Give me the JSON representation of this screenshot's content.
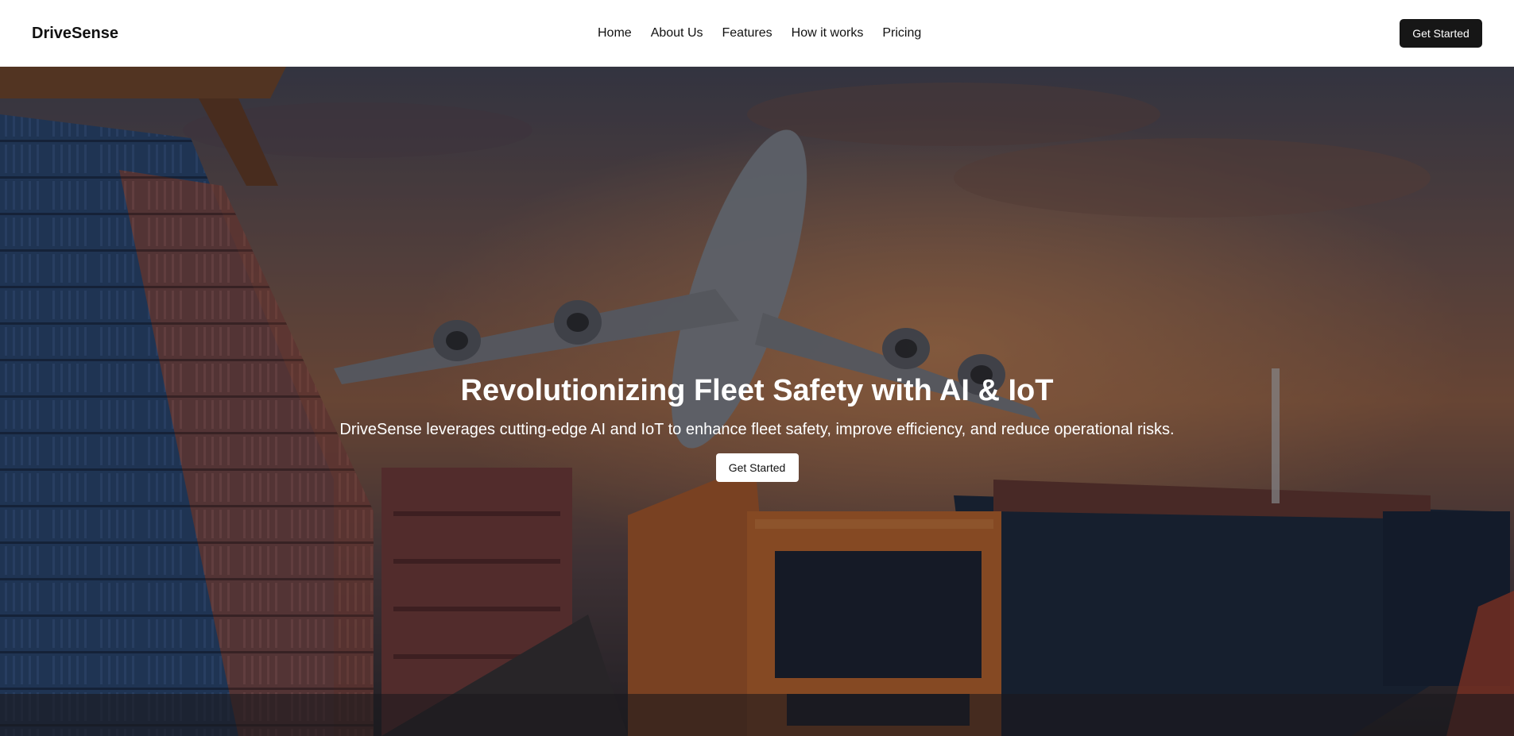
{
  "header": {
    "brand": "DriveSense",
    "nav": [
      {
        "label": "Home"
      },
      {
        "label": "About Us"
      },
      {
        "label": "Features"
      },
      {
        "label": "How it works"
      },
      {
        "label": "Pricing"
      }
    ],
    "cta_label": "Get Started"
  },
  "hero": {
    "title": "Revolutionizing Fleet Safety with AI & IoT",
    "subtitle": "DriveSense leverages cutting-edge AI and IoT to enhance fleet safety, improve efficiency, and reduce operational risks.",
    "cta_label": "Get Started",
    "background_image": "logistics-scene-airplane-truck-ship-containers"
  },
  "colors": {
    "nav_background": "#ffffff",
    "primary_button": "#161616",
    "hero_button": "#ffffff",
    "text_light": "#ffffff",
    "text_dark": "#111111"
  }
}
